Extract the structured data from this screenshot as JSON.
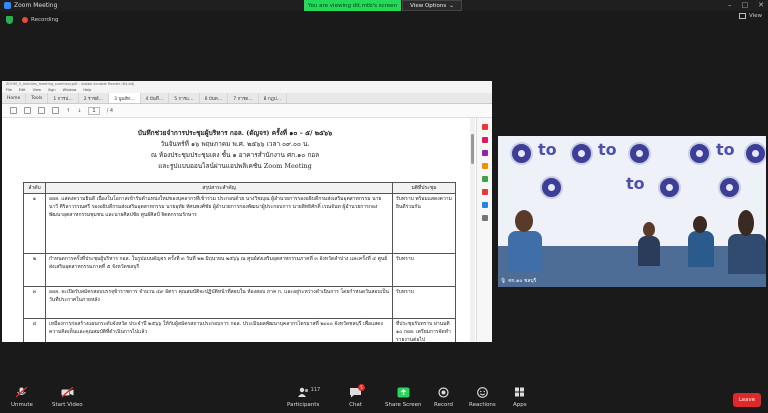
{
  "window": {
    "title": "Zoom Meeting"
  },
  "banner": {
    "viewing_text": "You are viewing dit.mtb's screen",
    "view_options": "View Options"
  },
  "status": {
    "recording": "Recording",
    "view": "View"
  },
  "doc": {
    "title_bar": "ZOOM_5_minutes_meeting_summary.pdf - Adobe Acrobat Reader (64-bit)",
    "menu": [
      "File",
      "Edit",
      "View",
      "Sign",
      "Window",
      "Help"
    ],
    "tabs": [
      "Home",
      "Tools",
      "1 การป…",
      "2 ราชย์…",
      "3 บูมส์ท…",
      "4 บันทึ…",
      "5 การแ…",
      "6 บันท…",
      "7 การด…",
      "8 กฎป…"
    ],
    "page_current": "1",
    "page_total": "/ 4",
    "heading_lines": [
      "บันทึกช่วยจำการประชุมผู้บริหาร กอล. (ดัญจร) ครั้งที่ ๑๐ – ๕/ ๒๕๖๖",
      "วันจันทร์ที่ ๑๖ พฤษภาคม พ.ศ. ๒๕๖๖ เวลา ๐๙.๐๐ น.",
      "ณ ห้องประชุมประชุมเดง ชั้น ๑ อาคารสำนักงาน ศก.๑๐ กอล",
      "และรูปแบบออนไลน์ผ่านแอปพลิเคชัน Zoom Meeting"
    ],
    "table": {
      "headers": [
        "ลำดับ",
        "สรุปสาระสำคัญ",
        "มติที่ประชุม"
      ],
      "rows": [
        {
          "no": "๑",
          "summary": "ออล. แสดงความยินดี เนื่องในโอกาสเข้ารับตำแหน่งใหม่ของบุคลากรที่เข้าร่วม ประกอบด้วย นางวิชญุณ ผู้อำนวยการรองอธิบดีกรมส่งเสริมอุตสาหกรรม นายนาวี ศิริลาวรรณศรี รองอธิบดีกรมส่งเสริมอุตสาหกรรม นายอุทัย ทัศนพงศ์ชัย ผู้อำนวยการกองพัฒนาผู้ประกอบการ นายสิทธิศักดิ์ เรณจันท ผู้อำนวยการกองพัฒนาอุตสาหกรรมชุมชน และนายศิลปชัย ศูนย์ศิลป์ จิตตกรรมรักษาร",
          "resolution": "รับทราบ พร้อมแสดงความยินดีร่วมกัน"
        },
        {
          "no": "๒",
          "summary": "กำหนดการครั้งที่ประชุมผู้บริหาร กอล. ในรูปแบบดัญจร ครั้งที่ ๓ วันที่ ๒๒ มิถุนายน ๒๕๖๖ ณ ศูนย์ส่งเสริมอุตสาหกรรมภาคที่ ๓ จังหวัดลำปาง และครั้งที่ ๔ ศูนย์ส่งเสริมอุตสาหกรรมภาคที่ ๕ จังหวัดชลบุรี",
          "resolution": "รับทราบ"
        },
        {
          "no": "๓",
          "summary": "ออล. จะเปิดรับสมัครสอบบรรจุข้าราชการ จำนวน ๔๙ อัตรา คุณสมบัติจะปฏิบัติหน้าที่สอบใน ห้องสอบ ภาค ก. และอยู่ระหว่างดำเนินการ โดยกำหนดวันสอบเป็นวันที่ประกาศในภายหลัง",
          "resolution": "รับทราบ"
        },
        {
          "no": "๔",
          "summary": "เหมืองการก่อสร้างแผนกระดับจังหวัด ประจำปี ๒๕๖๖ ให้กับผู้สมัครสถานประกอบการ กอล. ประเมินผลพัฒนาบุคลากรไตรมาสที่ ๒๐๐๐ จังหวัดชลบุรี เพื่อแสดงความคิดเห็นและคุณสมบัติที่ดำเนินการไปแล้ว",
          "resolution": "ที่ประชุมรับทราบ ผ่านมติ ๑๐ กอล. เตรียมการจัดทำรายงานต่อไป"
        }
      ]
    }
  },
  "video": {
    "participant_name": "ศก.๑๐ ชลบุรี"
  },
  "toolbar": {
    "unmute": "Unmute",
    "start_video": "Start Video",
    "participants": "Participants",
    "participants_count": "117",
    "chat": "Chat",
    "chat_badge": "5",
    "share_screen": "Share Screen",
    "record": "Record",
    "reactions": "Reactions",
    "apps": "Apps",
    "leave": "Leave"
  },
  "colors": {
    "share_green": "#23d959",
    "leave_red": "#e02828",
    "zoom_blue": "#2d8cff"
  }
}
